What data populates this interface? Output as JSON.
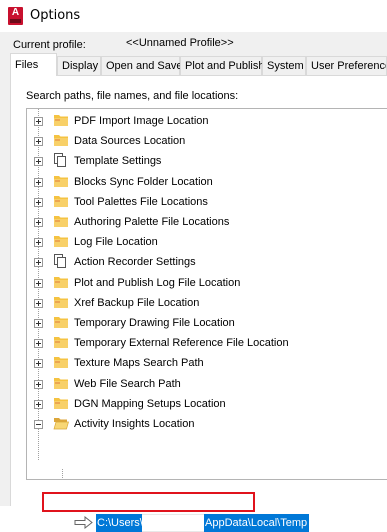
{
  "window": {
    "title": "Options",
    "app_icon": "autocad-icon"
  },
  "profile": {
    "label": "Current profile:",
    "value": "<<Unnamed Profile>>"
  },
  "tabs": [
    {
      "label": "Files",
      "active": true
    },
    {
      "label": "Display"
    },
    {
      "label": "Open and Save"
    },
    {
      "label": "Plot and Publish"
    },
    {
      "label": "System"
    },
    {
      "label": "User Preferences"
    }
  ],
  "files_panel": {
    "label": "Search paths, file names, and file locations:",
    "tree": [
      {
        "label": "PDF Import Image Location",
        "icon": "folder-icon",
        "expanded": false
      },
      {
        "label": "Data Sources Location",
        "icon": "folder-icon",
        "expanded": false
      },
      {
        "label": "Template Settings",
        "icon": "pages-icon",
        "expanded": false
      },
      {
        "label": "Blocks Sync Folder Location",
        "icon": "folder-icon",
        "expanded": false
      },
      {
        "label": "Tool Palettes File Locations",
        "icon": "folder-icon",
        "expanded": false
      },
      {
        "label": "Authoring Palette File Locations",
        "icon": "folder-icon",
        "expanded": false
      },
      {
        "label": "Log File Location",
        "icon": "folder-icon",
        "expanded": false
      },
      {
        "label": "Action Recorder Settings",
        "icon": "pages-icon",
        "expanded": false
      },
      {
        "label": "Plot and Publish Log File Location",
        "icon": "folder-icon",
        "expanded": false
      },
      {
        "label": "Xref Backup File Location",
        "icon": "folder-icon",
        "expanded": false
      },
      {
        "label": "Temporary Drawing File Location",
        "icon": "folder-icon",
        "expanded": false
      },
      {
        "label": "Temporary External Reference File Location",
        "icon": "folder-icon",
        "expanded": false
      },
      {
        "label": "Texture Maps Search Path",
        "icon": "folder-icon",
        "expanded": false
      },
      {
        "label": "Web File Search Path",
        "icon": "folder-icon",
        "expanded": false
      },
      {
        "label": "DGN Mapping Setups Location",
        "icon": "folder-icon",
        "expanded": false
      },
      {
        "label": "Activity Insights Location",
        "icon": "open-folder-icon",
        "expanded": true,
        "highlighted": true
      }
    ],
    "selected_child": {
      "path_start": "C:\\Users\\",
      "path_end": "AppData\\Local\\Temp",
      "icon": "arrow-right-icon"
    }
  },
  "colors": {
    "highlight_border": "#e0131c",
    "selection": "#0078d7",
    "folder": "#f5c342"
  }
}
